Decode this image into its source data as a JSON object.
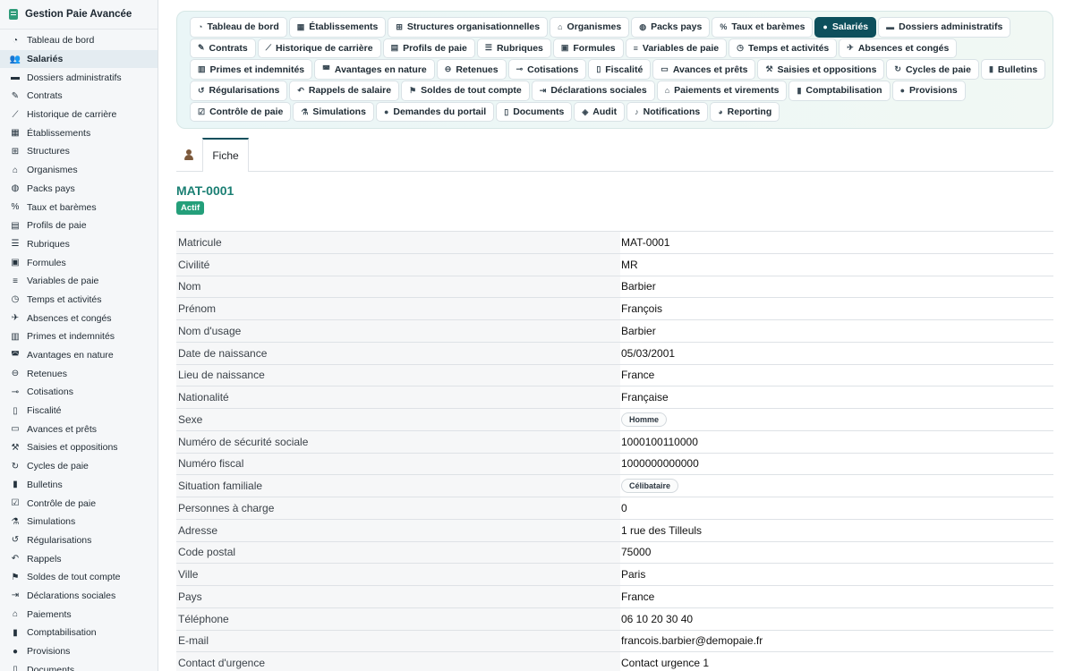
{
  "app": {
    "title": "Gestion Paie Avancée"
  },
  "sidebar": {
    "items": [
      {
        "label": "Tableau de bord",
        "icon": "gauge-icon"
      },
      {
        "label": "Salariés",
        "icon": "users-icon",
        "active": true
      },
      {
        "label": "Dossiers administratifs",
        "icon": "folder-icon"
      },
      {
        "label": "Contrats",
        "icon": "file-signature-icon"
      },
      {
        "label": "Historique de carrière",
        "icon": "chart-line-icon"
      },
      {
        "label": "Établissements",
        "icon": "building-icon"
      },
      {
        "label": "Structures",
        "icon": "sitemap-icon"
      },
      {
        "label": "Organismes",
        "icon": "landmark-icon"
      },
      {
        "label": "Packs pays",
        "icon": "globe-icon"
      },
      {
        "label": "Taux et barèmes",
        "icon": "percent-icon"
      },
      {
        "label": "Profils de paie",
        "icon": "id-card-icon"
      },
      {
        "label": "Rubriques",
        "icon": "list-icon"
      },
      {
        "label": "Formules",
        "icon": "calculator-icon"
      },
      {
        "label": "Variables de paie",
        "icon": "sliders-icon"
      },
      {
        "label": "Temps et activités",
        "icon": "clock-icon"
      },
      {
        "label": "Absences et congés",
        "icon": "plane-icon"
      },
      {
        "label": "Primes et indemnités",
        "icon": "gift-icon"
      },
      {
        "label": "Avantages en nature",
        "icon": "car-icon"
      },
      {
        "label": "Retenues",
        "icon": "minus-circle-icon"
      },
      {
        "label": "Cotisations",
        "icon": "hand-coin-icon"
      },
      {
        "label": "Fiscalité",
        "icon": "file-invoice-icon"
      },
      {
        "label": "Avances et prêts",
        "icon": "money-card-icon"
      },
      {
        "label": "Saisies et oppositions",
        "icon": "gavel-icon"
      },
      {
        "label": "Cycles de paie",
        "icon": "sync-icon"
      },
      {
        "label": "Bulletins",
        "icon": "file-icon"
      },
      {
        "label": "Contrôle de paie",
        "icon": "clipboard-check-icon"
      },
      {
        "label": "Simulations",
        "icon": "flask-icon"
      },
      {
        "label": "Régularisations",
        "icon": "undo-icon"
      },
      {
        "label": "Rappels",
        "icon": "history-icon"
      },
      {
        "label": "Soldes de tout compte",
        "icon": "flag-checkered-icon"
      },
      {
        "label": "Déclarations sociales",
        "icon": "file-export-icon"
      },
      {
        "label": "Paiements",
        "icon": "bank-icon"
      },
      {
        "label": "Comptabilisation",
        "icon": "book-icon"
      },
      {
        "label": "Provisions",
        "icon": "piggy-bank-icon"
      },
      {
        "label": "Documents",
        "icon": "document-icon"
      }
    ]
  },
  "tabs": [
    {
      "label": "Tableau de bord",
      "icon": "gauge-icon"
    },
    {
      "label": "Établissements",
      "icon": "building-icon"
    },
    {
      "label": "Structures organisationnelles",
      "icon": "sitemap-icon"
    },
    {
      "label": "Organismes",
      "icon": "landmark-icon"
    },
    {
      "label": "Packs pays",
      "icon": "globe-icon"
    },
    {
      "label": "Taux et barèmes",
      "icon": "percent-icon"
    },
    {
      "label": "Salariés",
      "icon": "user-icon",
      "active": true
    },
    {
      "label": "Dossiers administratifs",
      "icon": "folder-icon"
    },
    {
      "label": "Contrats",
      "icon": "file-signature-icon"
    },
    {
      "label": "Historique de carrière",
      "icon": "chart-line-icon"
    },
    {
      "label": "Profils de paie",
      "icon": "id-card-icon"
    },
    {
      "label": "Rubriques",
      "icon": "list-icon"
    },
    {
      "label": "Formules",
      "icon": "calculator-icon"
    },
    {
      "label": "Variables de paie",
      "icon": "sliders-icon"
    },
    {
      "label": "Temps et activités",
      "icon": "clock-icon"
    },
    {
      "label": "Absences et congés",
      "icon": "plane-icon"
    },
    {
      "label": "Primes et indemnités",
      "icon": "gift-icon"
    },
    {
      "label": "Avantages en nature",
      "icon": "car-icon"
    },
    {
      "label": "Retenues",
      "icon": "minus-circle-icon"
    },
    {
      "label": "Cotisations",
      "icon": "hand-coin-icon"
    },
    {
      "label": "Fiscalité",
      "icon": "file-invoice-icon"
    },
    {
      "label": "Avances et prêts",
      "icon": "money-card-icon"
    },
    {
      "label": "Saisies et oppositions",
      "icon": "gavel-icon"
    },
    {
      "label": "Cycles de paie",
      "icon": "sync-icon"
    },
    {
      "label": "Bulletins",
      "icon": "file-icon"
    },
    {
      "label": "Régularisations",
      "icon": "undo-icon"
    },
    {
      "label": "Rappels de salaire",
      "icon": "history-icon"
    },
    {
      "label": "Soldes de tout compte",
      "icon": "flag-checkered-icon"
    },
    {
      "label": "Déclarations sociales",
      "icon": "file-export-icon"
    },
    {
      "label": "Paiements et virements",
      "icon": "bank-icon"
    },
    {
      "label": "Comptabilisation",
      "icon": "book-icon"
    },
    {
      "label": "Provisions",
      "icon": "piggy-bank-icon"
    },
    {
      "label": "Contrôle de paie",
      "icon": "clipboard-check-icon"
    },
    {
      "label": "Simulations",
      "icon": "flask-icon"
    },
    {
      "label": "Demandes du portail",
      "icon": "comment-icon"
    },
    {
      "label": "Documents",
      "icon": "document-icon"
    },
    {
      "label": "Audit",
      "icon": "shield-icon"
    },
    {
      "label": "Notifications",
      "icon": "bell-icon"
    },
    {
      "label": "Reporting",
      "icon": "pie-chart-icon"
    }
  ],
  "subtabs": {
    "fiche_label": "Fiche",
    "user_icon": "user-icon"
  },
  "employee": {
    "id": "MAT-0001",
    "status": "Actif",
    "colors": {
      "accent": "#1a7f73",
      "badge": "#249f7a",
      "active_tab": "#0d4f5c"
    }
  },
  "fields": [
    {
      "label": "Matricule",
      "value": "MAT-0001"
    },
    {
      "label": "Civilité",
      "value": "MR"
    },
    {
      "label": "Nom",
      "value": "Barbier"
    },
    {
      "label": "Prénom",
      "value": "François"
    },
    {
      "label": "Nom d'usage",
      "value": "Barbier"
    },
    {
      "label": "Date de naissance",
      "value": "05/03/2001"
    },
    {
      "label": "Lieu de naissance",
      "value": "France"
    },
    {
      "label": "Nationalité",
      "value": "Française"
    },
    {
      "label": "Sexe",
      "value": "Homme",
      "pill": true
    },
    {
      "label": "Numéro de sécurité sociale",
      "value": "1000100110000"
    },
    {
      "label": "Numéro fiscal",
      "value": "1000000000000"
    },
    {
      "label": "Situation familiale",
      "value": "Célibataire",
      "pill": true
    },
    {
      "label": "Personnes à charge",
      "value": "0"
    },
    {
      "label": "Adresse",
      "value": "1 rue des Tilleuls"
    },
    {
      "label": "Code postal",
      "value": "75000"
    },
    {
      "label": "Ville",
      "value": "Paris"
    },
    {
      "label": "Pays",
      "value": "France"
    },
    {
      "label": "Téléphone",
      "value": "06 10 20 30 40"
    },
    {
      "label": "E-mail",
      "value": "francois.barbier@demopaie.fr"
    },
    {
      "label": "Contact d'urgence",
      "value": "Contact urgence 1"
    }
  ]
}
